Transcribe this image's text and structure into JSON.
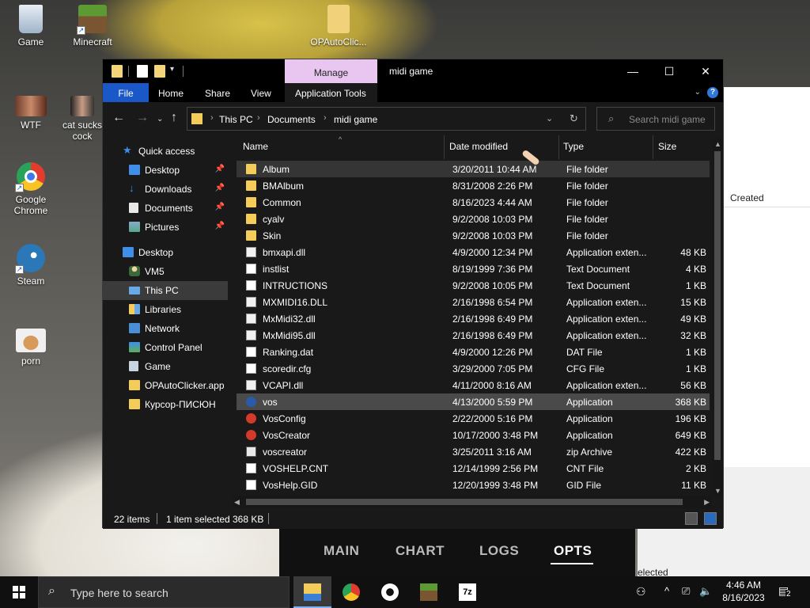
{
  "desktop": {
    "icons": [
      {
        "label": "Game"
      },
      {
        "label": "Minecraft"
      },
      {
        "label": "OPAutoClic..."
      },
      {
        "label": "WTF"
      },
      {
        "label": "cat sucks cock"
      },
      {
        "label": "Google Chrome"
      },
      {
        "label": "Steam"
      },
      {
        "label": "porn"
      }
    ]
  },
  "background_window": {
    "column_header": "Created",
    "partial_text": "elected"
  },
  "app_nav": {
    "tabs": [
      {
        "label": "MAIN"
      },
      {
        "label": "CHART"
      },
      {
        "label": "LOGS"
      },
      {
        "label": "OPTS"
      }
    ],
    "active": "OPTS"
  },
  "explorer": {
    "title": "midi game",
    "manage_tab": "Manage",
    "ribbon_tabs": [
      {
        "label": "File"
      },
      {
        "label": "Home"
      },
      {
        "label": "Share"
      },
      {
        "label": "View"
      },
      {
        "label": "Application Tools"
      }
    ],
    "window_buttons": {
      "minimize": "—",
      "maximize": "☐",
      "close": "✕"
    },
    "address": {
      "crumbs": [
        "This PC",
        "Documents",
        "midi game"
      ]
    },
    "search_placeholder": "Search midi game",
    "nav_pane": [
      {
        "label": "Quick access",
        "icon": "star-icon"
      },
      {
        "label": "Desktop",
        "icon": "desktop-icon",
        "pinned": true
      },
      {
        "label": "Downloads",
        "icon": "download-icon",
        "pinned": true
      },
      {
        "label": "Documents",
        "icon": "documents-icon",
        "pinned": true
      },
      {
        "label": "Pictures",
        "icon": "pictures-icon",
        "pinned": true
      },
      {
        "label": "Desktop",
        "icon": "desktop-icon"
      },
      {
        "label": "VM5",
        "icon": "user-icon"
      },
      {
        "label": "This PC",
        "icon": "pc-icon",
        "selected": true
      },
      {
        "label": "Libraries",
        "icon": "library-icon"
      },
      {
        "label": "Network",
        "icon": "network-icon"
      },
      {
        "label": "Control Panel",
        "icon": "control-panel-icon"
      },
      {
        "label": "Game",
        "icon": "recycle-bin-icon"
      },
      {
        "label": "OPAutoClicker.app",
        "icon": "folder-icon"
      },
      {
        "label": "Курсор-ПИСЮН",
        "icon": "folder-icon"
      }
    ],
    "columns": {
      "name": "Name",
      "date": "Date modified",
      "type": "Type",
      "size": "Size"
    },
    "files": [
      {
        "name": "Album",
        "date": "3/20/2011 10:44 AM",
        "type": "File folder",
        "size": "",
        "icon": "folder-icon"
      },
      {
        "name": "BMAlbum",
        "date": "8/31/2008 2:26 PM",
        "type": "File folder",
        "size": "",
        "icon": "folder-icon"
      },
      {
        "name": "Common",
        "date": "8/16/2023 4:44 AM",
        "type": "File folder",
        "size": "",
        "icon": "folder-icon"
      },
      {
        "name": "cyalv",
        "date": "9/2/2008 10:03 PM",
        "type": "File folder",
        "size": "",
        "icon": "folder-icon"
      },
      {
        "name": "Skin",
        "date": "9/2/2008 10:03 PM",
        "type": "File folder",
        "size": "",
        "icon": "folder-icon"
      },
      {
        "name": "bmxapi.dll",
        "date": "4/9/2000 12:34 PM",
        "type": "Application exten...",
        "size": "48 KB",
        "icon": "dll-icon"
      },
      {
        "name": "instlist",
        "date": "8/19/1999 7:36 PM",
        "type": "Text Document",
        "size": "4 KB",
        "icon": "text-document-icon"
      },
      {
        "name": "INTRUCTIONS",
        "date": "9/2/2008 10:05 PM",
        "type": "Text Document",
        "size": "1 KB",
        "icon": "text-document-icon"
      },
      {
        "name": "MXMIDI16.DLL",
        "date": "2/16/1998 6:54 PM",
        "type": "Application exten...",
        "size": "15 KB",
        "icon": "dll-icon"
      },
      {
        "name": "MxMidi32.dll",
        "date": "2/16/1998 6:49 PM",
        "type": "Application exten...",
        "size": "49 KB",
        "icon": "dll-icon"
      },
      {
        "name": "MxMidi95.dll",
        "date": "2/16/1998 6:49 PM",
        "type": "Application exten...",
        "size": "32 KB",
        "icon": "dll-icon"
      },
      {
        "name": "Ranking.dat",
        "date": "4/9/2000 12:26 PM",
        "type": "DAT File",
        "size": "1 KB",
        "icon": "file-icon"
      },
      {
        "name": "scoredir.cfg",
        "date": "3/29/2000 7:05 PM",
        "type": "CFG File",
        "size": "1 KB",
        "icon": "file-icon"
      },
      {
        "name": "VCAPI.dll",
        "date": "4/11/2000 8:16 AM",
        "type": "Application exten...",
        "size": "56 KB",
        "icon": "dll-icon"
      },
      {
        "name": "vos",
        "date": "4/13/2000 5:59 PM",
        "type": "Application",
        "size": "368 KB",
        "icon": "app-icon",
        "selected": true
      },
      {
        "name": "VosConfig",
        "date": "2/22/2000 5:16 PM",
        "type": "Application",
        "size": "196 KB",
        "icon": "red-app-icon"
      },
      {
        "name": "VosCreator",
        "date": "10/17/2000 3:48 PM",
        "type": "Application",
        "size": "649 KB",
        "icon": "red-app-icon"
      },
      {
        "name": "voscreator",
        "date": "3/25/2011 3:16 AM",
        "type": "zip Archive",
        "size": "422 KB",
        "icon": "zip-icon"
      },
      {
        "name": "VOSHELP.CNT",
        "date": "12/14/1999 2:56 PM",
        "type": "CNT File",
        "size": "2 KB",
        "icon": "file-icon"
      },
      {
        "name": "VosHelp.GID",
        "date": "12/20/1999 3:48 PM",
        "type": "GID File",
        "size": "11 KB",
        "icon": "file-icon"
      }
    ],
    "status": {
      "items": "22 items",
      "selected": "1 item selected",
      "size": "368 KB"
    }
  },
  "taskbar": {
    "search_placeholder": "Type here to search",
    "time": "4:46 AM",
    "date": "8/16/2023",
    "notifications": "2"
  },
  "colors": {
    "explorer_bg": "#191919",
    "file_tab": "#1b58c7",
    "manage_tab": "#e8c6f0",
    "folder": "#f4cc5a",
    "selected_row": "#4a4a4a",
    "taskbar": "#101010"
  }
}
